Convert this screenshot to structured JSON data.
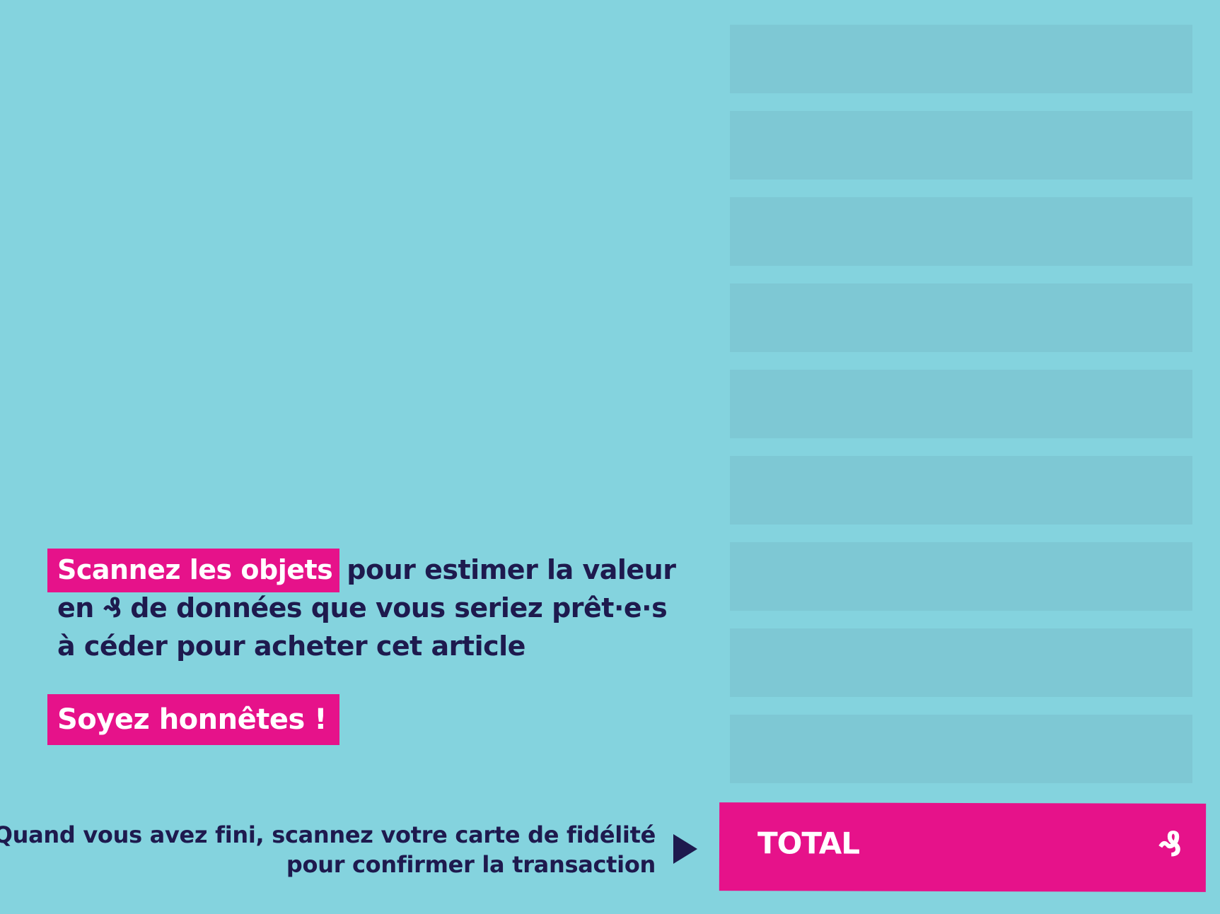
{
  "slots_count": 9,
  "instructions": {
    "highlight": "Scannez les objets",
    "line1_rest": "pour estimer la valeur",
    "line2_prefix": "en",
    "currency_symbol": "₰",
    "line2_rest": "de données que vous seriez prêt·e·s",
    "line3": "à céder pour acheter cet article"
  },
  "honest": "Soyez honnêtes !",
  "footer": {
    "line1": "Quand vous avez fini, scannez votre carte de fidélité",
    "line2": "pour confirmer la transaction"
  },
  "total": {
    "label": "TOTAL",
    "currency": "₰"
  },
  "colors": {
    "background": "#84d3de",
    "slot": "#7ec8d4",
    "accent": "#e6128a",
    "text": "#1e1a4e"
  }
}
